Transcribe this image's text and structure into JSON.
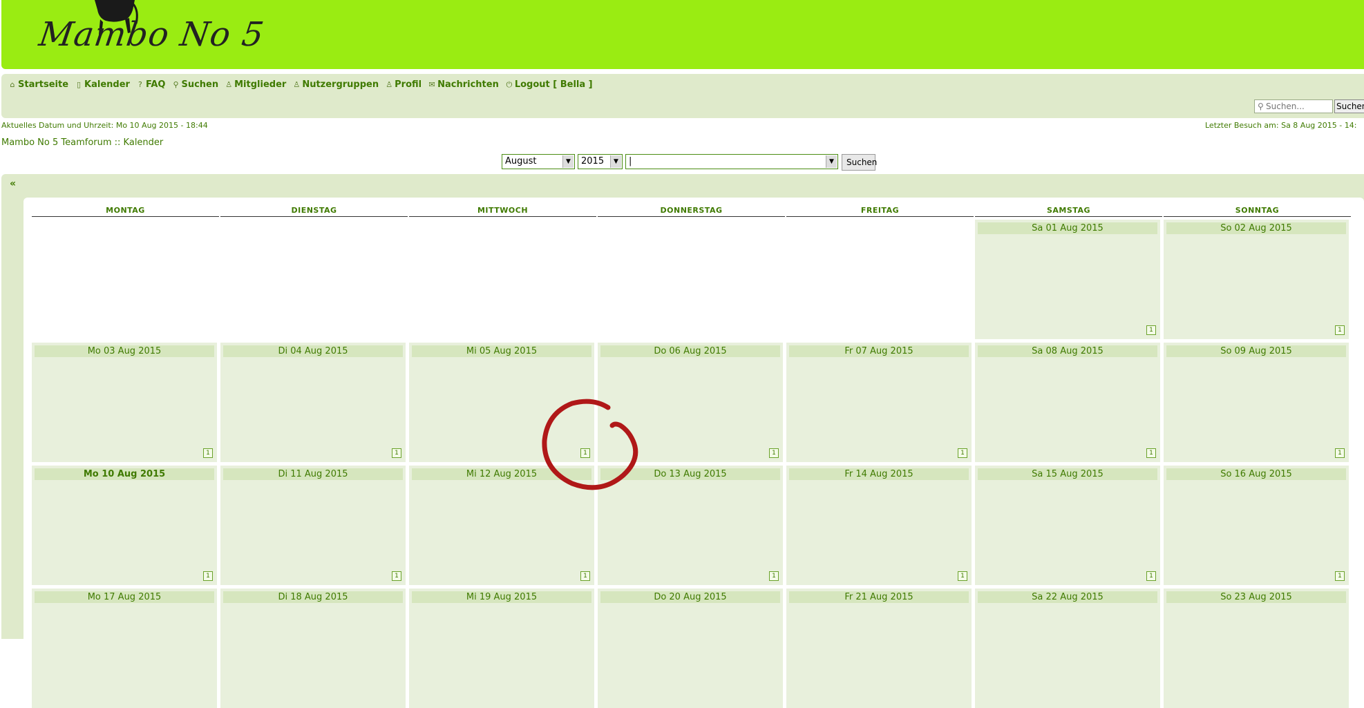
{
  "header": {
    "logo_text": "Mambo No 5"
  },
  "nav": {
    "items": [
      {
        "label": "Startseite",
        "icon": "home-icon",
        "glyph": "⌂"
      },
      {
        "label": "Kalender",
        "icon": "calendar-icon",
        "glyph": "▯"
      },
      {
        "label": "FAQ",
        "icon": "faq-icon",
        "glyph": "?"
      },
      {
        "label": "Suchen",
        "icon": "search-icon",
        "glyph": "⚲"
      },
      {
        "label": "Mitglieder",
        "icon": "members-icon",
        "glyph": "♙"
      },
      {
        "label": "Nutzergruppen",
        "icon": "groups-icon",
        "glyph": "♙"
      },
      {
        "label": "Profil",
        "icon": "profile-icon",
        "glyph": "♙"
      },
      {
        "label": "Nachrichten",
        "icon": "mail-icon",
        "glyph": "✉"
      },
      {
        "label": "Logout [ Bella ]",
        "icon": "logout-icon",
        "glyph": "⏻"
      }
    ],
    "search_placeholder": "Suchen...",
    "search_button": "Suchen"
  },
  "info": {
    "current_date": "Aktuelles Datum und Uhrzeit: Mo 10 Aug 2015 - 18:44",
    "last_visit": "Letzter Besuch am: Sa 8 Aug 2015 - 14:",
    "breadcrumb": "Mambo No 5 Teamforum :: Kalender"
  },
  "filters": {
    "month": "August",
    "year": "2015",
    "forum": "|",
    "go_button": "Suchen"
  },
  "calendar": {
    "prev_label": "«",
    "add_icon_text": "1",
    "weekdays": [
      "MONTAG",
      "DIENSTAG",
      "MITTWOCH",
      "DONNERSTAG",
      "FREITAG",
      "SAMSTAG",
      "SONNTAG"
    ],
    "weeks": [
      [
        "",
        "",
        "",
        "",
        "",
        "Sa 01 Aug 2015",
        "So 02 Aug 2015"
      ],
      [
        "Mo 03 Aug 2015",
        "Di 04 Aug 2015",
        "Mi 05 Aug 2015",
        "Do 06 Aug 2015",
        "Fr 07 Aug 2015",
        "Sa 08 Aug 2015",
        "So 09 Aug 2015"
      ],
      [
        "Mo 10 Aug 2015",
        "Di 11 Aug 2015",
        "Mi 12 Aug 2015",
        "Do 13 Aug 2015",
        "Fr 14 Aug 2015",
        "Sa 15 Aug 2015",
        "So 16 Aug 2015"
      ],
      [
        "Mo 17 Aug 2015",
        "Di 18 Aug 2015",
        "Mi 19 Aug 2015",
        "Do 20 Aug 2015",
        "Fr 21 Aug 2015",
        "Sa 22 Aug 2015",
        "So 23 Aug 2015"
      ]
    ],
    "today": "Mo 10 Aug 2015"
  },
  "colors": {
    "header_bg": "#9aec12",
    "panel_bg": "#dfeacb",
    "link": "#3f7a00",
    "annotation": "#b01818"
  }
}
